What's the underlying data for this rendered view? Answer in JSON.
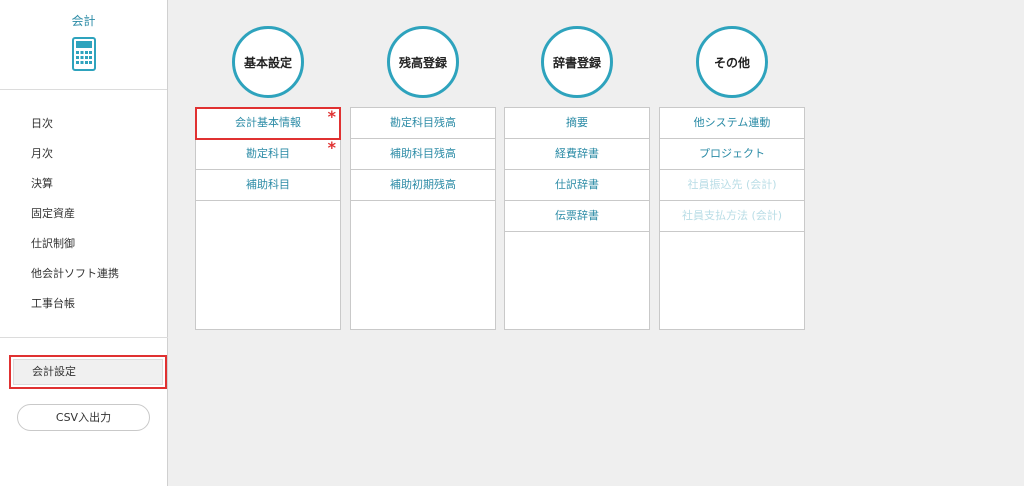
{
  "sidebar": {
    "app_title": "会計",
    "app_icon": "calculator-icon",
    "nav_items": [
      "日次",
      "月次",
      "決算",
      "固定資産",
      "仕訳制御",
      "他会計ソフト連携",
      "工事台帳"
    ],
    "settings_button": "会計設定",
    "csv_button": "CSV入出力"
  },
  "columns": [
    {
      "title": "基本設定",
      "items": [
        {
          "label": "会計基本情報",
          "required": true,
          "highlighted": true,
          "disabled": false
        },
        {
          "label": "勘定科目",
          "required": true,
          "highlighted": false,
          "disabled": false
        },
        {
          "label": "補助科目",
          "required": false,
          "highlighted": false,
          "disabled": false
        }
      ]
    },
    {
      "title": "残高登録",
      "items": [
        {
          "label": "勘定科目残高",
          "required": false,
          "highlighted": false,
          "disabled": false
        },
        {
          "label": "補助科目残高",
          "required": false,
          "highlighted": false,
          "disabled": false
        },
        {
          "label": "補助初期残高",
          "required": false,
          "highlighted": false,
          "disabled": false
        }
      ]
    },
    {
      "title": "辞書登録",
      "items": [
        {
          "label": "摘要",
          "required": false,
          "highlighted": false,
          "disabled": false
        },
        {
          "label": "経費辞書",
          "required": false,
          "highlighted": false,
          "disabled": false
        },
        {
          "label": "仕訳辞書",
          "required": false,
          "highlighted": false,
          "disabled": false
        },
        {
          "label": "伝票辞書",
          "required": false,
          "highlighted": false,
          "disabled": false
        }
      ]
    },
    {
      "title": "その他",
      "items": [
        {
          "label": "他システム連動",
          "required": false,
          "highlighted": false,
          "disabled": false
        },
        {
          "label": "プロジェクト",
          "required": false,
          "highlighted": false,
          "disabled": false
        },
        {
          "label": "社員振込先 (会計)",
          "required": false,
          "highlighted": false,
          "disabled": true
        },
        {
          "label": "社員支払方法 (会計)",
          "required": false,
          "highlighted": false,
          "disabled": true
        }
      ]
    }
  ],
  "required_mark": "*",
  "colors": {
    "accent": "#2ea3bd",
    "link": "#2b8ba6",
    "highlight": "#e03131",
    "disabled": "#b9dde6"
  }
}
